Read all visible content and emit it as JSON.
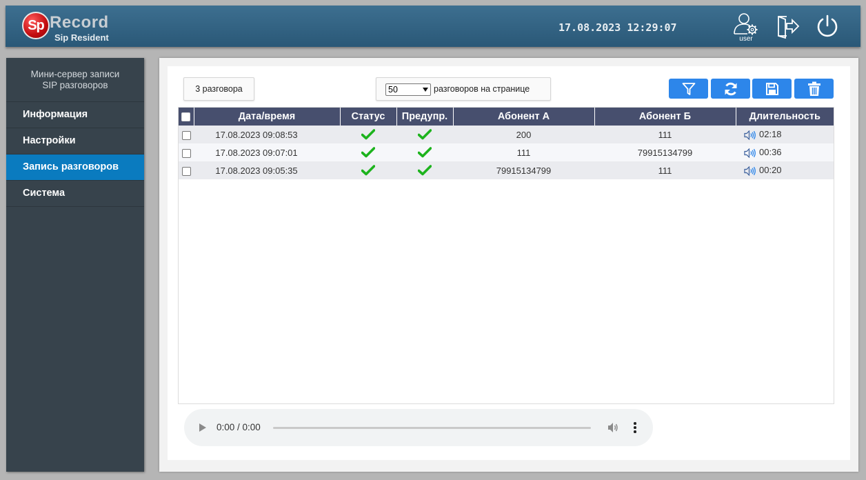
{
  "header": {
    "logo_prefix": "Sp",
    "logo_name": "Record",
    "logo_sub": "Sip Resident",
    "datetime": "17.08.2023 12:29:07",
    "user_label": "user",
    "icons": [
      "user-settings-icon",
      "logout-icon",
      "power-icon"
    ]
  },
  "sidebar": {
    "title_line1": "Мини-сервер записи",
    "title_line2": "SIP разговоров",
    "items": [
      {
        "label": "Информация",
        "active": false
      },
      {
        "label": "Настройки",
        "active": false
      },
      {
        "label": "Запись разговоров",
        "active": true
      },
      {
        "label": "Система",
        "active": false
      }
    ],
    "active_color": "#0a7bbf"
  },
  "toolbar": {
    "count_label": "3 разговора",
    "perpage_value": "50",
    "perpage_label": "разговоров на странице",
    "buttons": [
      "filter-icon",
      "refresh-icon",
      "save-icon",
      "trash-icon"
    ],
    "button_color": "#2d86ea"
  },
  "table": {
    "columns": [
      "Дата/время",
      "Статус",
      "Предупр.",
      "Абонент А",
      "Абонент Б",
      "Длительность"
    ],
    "rows": [
      {
        "datetime": "17.08.2023 09:08:53",
        "status": "check",
        "warning": "check",
        "a": "200",
        "b": "111",
        "duration": "02:18"
      },
      {
        "datetime": "17.08.2023 09:07:01",
        "status": "check",
        "warning": "check",
        "a": "111",
        "b": "79915134799",
        "duration": "00:36"
      },
      {
        "datetime": "17.08.2023 09:05:35",
        "status": "check",
        "warning": "check",
        "a": "79915134799",
        "b": "111",
        "duration": "00:20"
      }
    ],
    "header_color": "#474f6e",
    "check_color": "#1db31d"
  },
  "player": {
    "time": "0:00 / 0:00"
  }
}
